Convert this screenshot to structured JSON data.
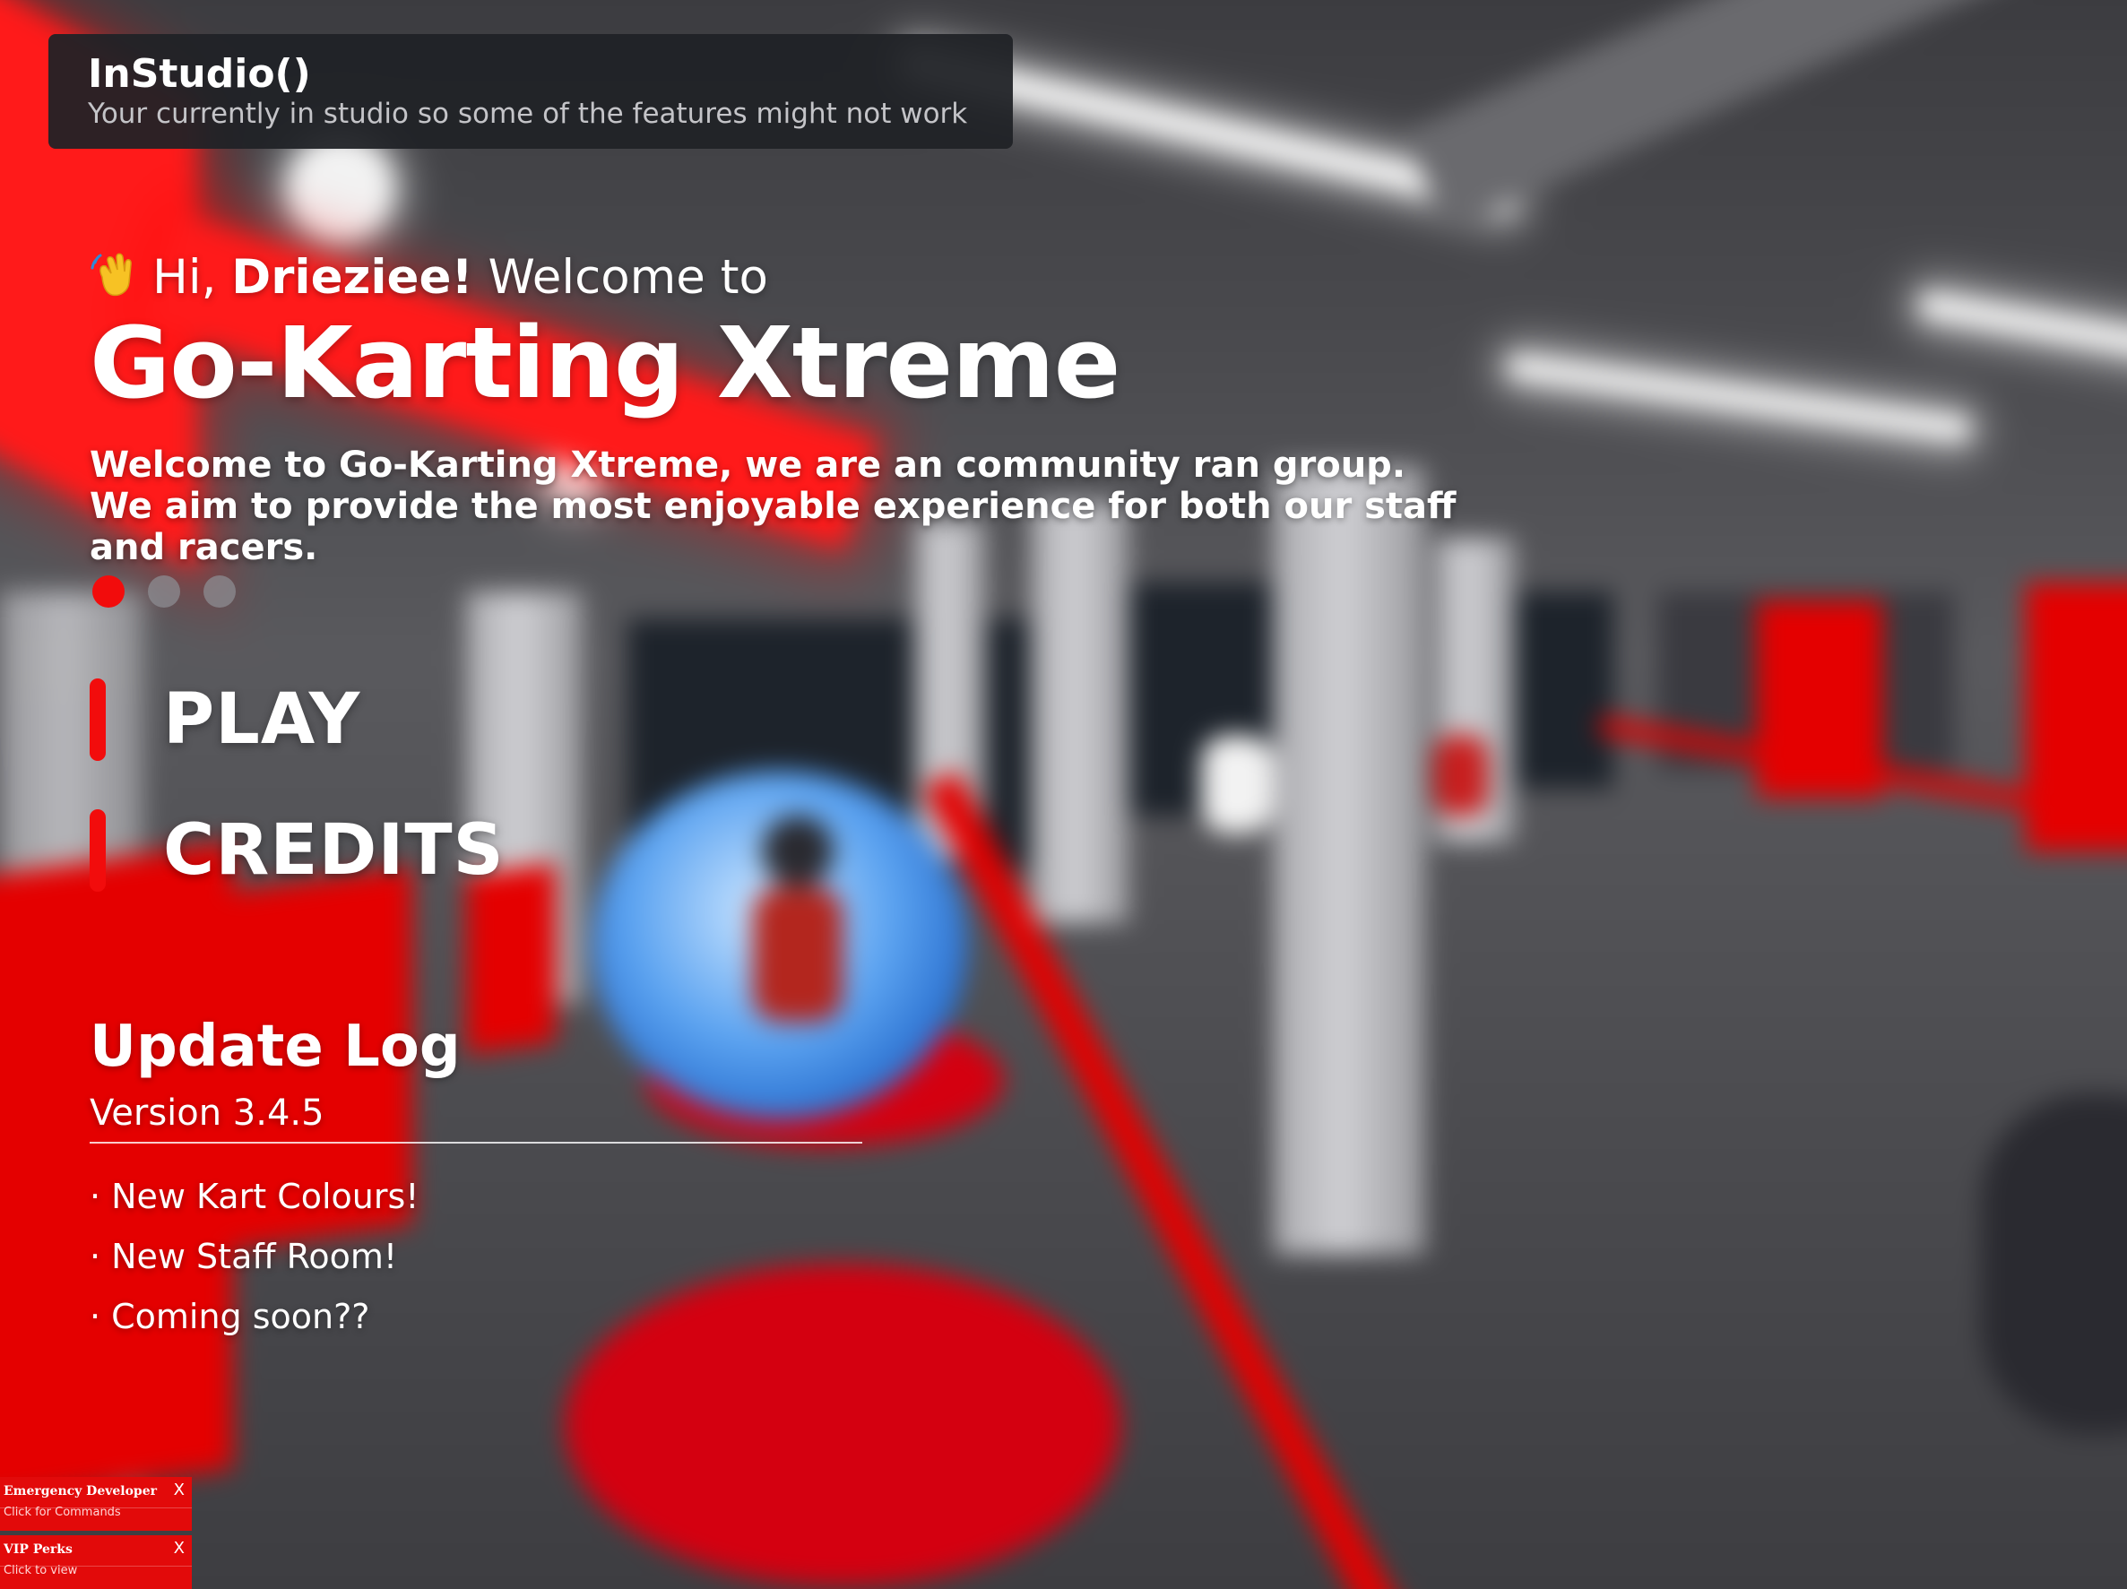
{
  "studio_banner": {
    "title": "InStudio()",
    "message": "Your currently in studio so some of the features might not work"
  },
  "welcome": {
    "wave_icon": "waving-hand-icon",
    "greeting_prefix": "Hi,",
    "username": "Drieziee!",
    "greeting_suffix": "Welcome to",
    "game_title": "Go-Karting Xtreme",
    "description": "Welcome to Go-Karting Xtreme, we are an community ran group. We aim to provide the most enjoyable experience for both our staff and racers.",
    "carousel_active_index": 0
  },
  "menu": {
    "play_label": "PLAY",
    "credits_label": "CREDITS"
  },
  "update_log": {
    "title": "Update Log",
    "version": "Version 3.4.5",
    "bullet": "·",
    "items": [
      "New Kart Colours!",
      "New Staff Room!",
      "Coming soon??"
    ]
  },
  "side_panels": {
    "emergency": {
      "title": "Emergency Developer",
      "subtitle": "Click for Commands",
      "close": "X"
    },
    "vip": {
      "title": "VIP Perks",
      "subtitle": "Click to view",
      "close": "X"
    }
  },
  "colors": {
    "accent_red": "#f20c0c",
    "banner_bg": "#202226",
    "panel_red": "#e20a0a"
  }
}
